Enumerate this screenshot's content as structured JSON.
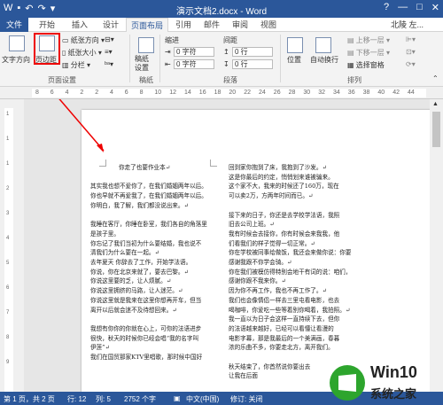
{
  "window": {
    "title": "演示文档2.docx - Word",
    "controls": [
      "?",
      "—",
      "□",
      "✕"
    ]
  },
  "tabs": [
    "文件",
    "开始",
    "插入",
    "设计",
    "页面布局",
    "引用",
    "邮件",
    "审阅",
    "视图"
  ],
  "user": "北陵 左...",
  "ribbon": {
    "page_setup": {
      "label": "页面设置",
      "text_direction": "文字方向",
      "margins": "页边距",
      "orientation": "纸张方向",
      "size": "纸张大小",
      "columns": "分栏"
    },
    "paper": {
      "label": "稿纸",
      "settings": "稿纸\n设置"
    },
    "paragraph": {
      "label": "段落",
      "indent": "缩进",
      "spacing": "间距",
      "indent_left": "0 字符",
      "indent_right": "0 字符",
      "spacing_before": "0 行",
      "spacing_after": "0 行"
    },
    "arrange": {
      "label": "排列",
      "position": "位置",
      "wrap": "自动换行",
      "bring_forward": "上移一层",
      "send_backward": "下移一层",
      "selection_pane": "选择窗格"
    }
  },
  "ruler_numbers": [
    "8",
    "6",
    "4",
    "2",
    "2",
    "4",
    "6",
    "8",
    "10",
    "12",
    "14",
    "16",
    "18",
    "20",
    "22",
    "24",
    "26",
    "28",
    "30",
    "32",
    "34",
    "36",
    "38",
    "40",
    "42",
    "44"
  ],
  "vruler_numbers": [
    "1",
    "1",
    "1",
    "2",
    "3",
    "4",
    "5",
    "6",
    "7",
    "8",
    "9"
  ],
  "document": {
    "left_column": [
      "你走了也要作业本↵",
      "",
      "其实我也想不爱你了，在我们婚姻两年以后。",
      "你也早就不再爱我了，在我们婚姻两年以后。",
      "你明白，我了解，我们都没说出来。↵",
      "",
      "我睡在客厅，你睡在卧室，我们各自的角落里",
      "是孩子里。",
      "你忘记了我们当初为什么要结婚，我也说不",
      "清我们为什么要在一起。↵",
      "去年夏天 你辞去了工作，开始学法语。",
      "你说，你在北京来就了，要去巴黎。↵",
      "你说这里要的乏，让人烦腻。↵",
      "你说这里拥挤的马路，让人迷茫。↵",
      "你说这里就是我来在这里你想再开车，但当",
      "离开以后就会迷不及待想回来。↵",
      "",
      "我想有你你的你就在心上，可你的法语进步",
      "很快，秋天的时候你已经会唱“我的名字叫",
      "伊莲”↵",
      "我们在国贸那家KTV里唱歌，那时候中国好"
    ],
    "right_column": [
      "回到家你抱到了床，我抱到了沙发。↵",
      "这是你最后的约定，悄悄划来谁被骗来。",
      "这个家不大，我来的时候还了160万，现在",
      "可以卖2万，方两年时间而已。↵",
      "",
      "接下来的日子，你还是去学校学法语，我照",
      "旧去公司上班。↵",
      "我有时候会去接你，你有时候会来我我，他",
      "们看我们的样子觉得一切正常。↵",
      "你在学校被同事给做饭，我还会来做你说：你要",
      "感谢我跟不你学会骑。↵",
      "你在我们被模仿得特别会地干有词的说：咱们，",
      "感谢你跟不我来你。↵",
      "因为你不再工作，我也不再工作了。↵",
      "我们也会像情侣一样去三里屯看电影，也去",
      "喝咖啡，你爱吃一些等着别你喝着，我拍照。↵",
      "我一直以为日子会这样一直持续下去，但你",
      "的法语越来越好，已经可以看懂让看漫的",
      "电影字幕，那是我最后的一个美满画，春暮",
      "浓的乐曲不多，你要走北方，离开我们。",
      "",
      "秋天结束了，你首然说你要出去",
      "让我在后面"
    ]
  },
  "status": {
    "page": "第 1 页，共 2 页",
    "row": "行: 12",
    "col": "列: 5",
    "words": "2752 个字",
    "lang": "中文(中国)",
    "track": "修订: 关闭"
  },
  "watermark": {
    "brand": "Win10",
    "subtitle": "系统之家"
  },
  "colors": {
    "accent": "#2b579a",
    "highlight": "#e00000"
  }
}
